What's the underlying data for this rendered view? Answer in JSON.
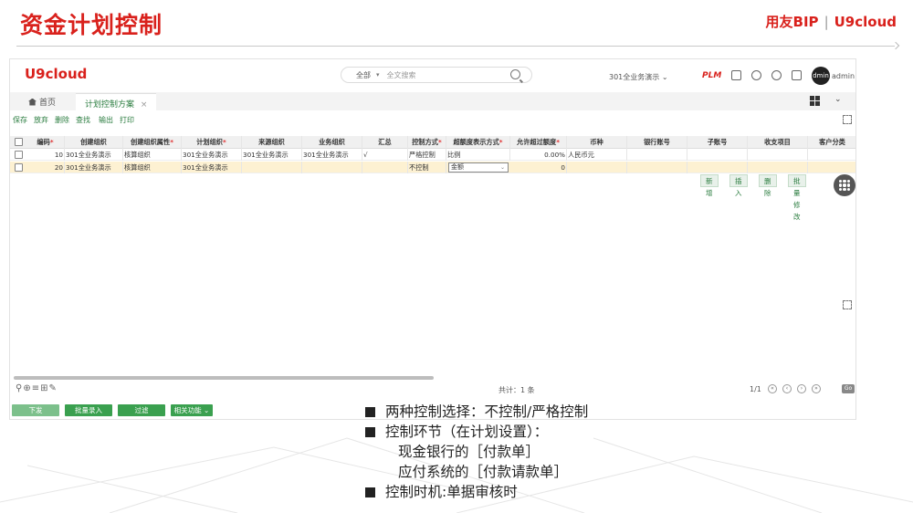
{
  "slide": {
    "title": "资金计划控制",
    "brand_left": "用友BIP",
    "brand_sep": "|",
    "brand_right": "U9cloud"
  },
  "app": {
    "logo": "U9cloud",
    "search": {
      "scope": "全部",
      "placeholder": "全文搜索"
    },
    "org": "301全业务演示",
    "plm": "PLM",
    "avatar": "dmin",
    "user": "admin",
    "tabs": {
      "home": "首页",
      "active": "计划控制方案",
      "close": "×"
    },
    "toolbar": [
      "保存",
      "放弃",
      "删除",
      "查找",
      "输出",
      "打印"
    ],
    "columns": [
      "编码",
      "创建组织",
      "创建组织属性",
      "计划组织",
      "来源组织",
      "业务组织",
      "汇总",
      "控制方式",
      "超额度表示方式",
      "允许超过额度",
      "币种",
      "银行账号",
      "子账号",
      "收支项目",
      "客户分类"
    ],
    "required": [
      "编码",
      "创建组织属性",
      "计划组织",
      "控制方式",
      "超额度表示方式",
      "允许超过额度"
    ],
    "rows": [
      [
        "10",
        "301全业务演示",
        "核算组织",
        "301全业务演示",
        "301全业务演示",
        "301全业务演示",
        "√",
        "严格控制",
        "比例",
        "0.00%",
        "人民币元",
        "",
        "",
        "",
        ""
      ],
      [
        "20",
        "301全业务演示",
        "核算组织",
        "301全业务演示",
        "",
        "",
        "",
        "不控制",
        "金额",
        "0",
        "",
        "",
        "",
        "",
        ""
      ]
    ],
    "row_actions": [
      "新增",
      "插入",
      "删除",
      "批量修改"
    ],
    "footer": {
      "total": "共计：1 条",
      "page": "1/1",
      "go": "Go"
    },
    "bottom_buttons": [
      "下发",
      "批量录入",
      "过滤",
      "相关功能 ⌄"
    ]
  },
  "bullets": {
    "b1": "两种控制选择：不控制/严格控制",
    "b2": "控制环节（在计划设置）：",
    "s1": "现金银行的［付款单］",
    "s2": "应付系统的［付款请款单］",
    "b3": "控制时机:单据审核时"
  },
  "colors": {
    "brand": "#d9211c",
    "accent": "#2a7c3f",
    "highlight_row": "#fdf1d2"
  }
}
